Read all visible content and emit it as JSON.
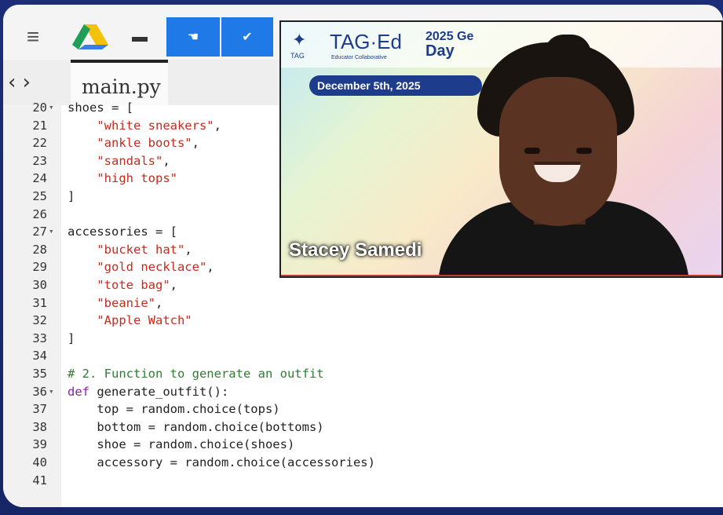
{
  "toolbar": {
    "menu_icon": "hamburger-icon",
    "drive_icon": "drive-icon",
    "hat_icon": "hat-icon",
    "hand_icon": "hand-icon",
    "check_icon": "check-icon"
  },
  "tab": {
    "filename": "main.py"
  },
  "code_lines": [
    {
      "n": "20",
      "fold": "▾",
      "parts": [
        [
          "",
          "shoes = ["
        ]
      ]
    },
    {
      "n": "21",
      "fold": "",
      "parts": [
        [
          "str",
          "    \"white sneakers\""
        ],
        [
          "",
          ","
        ]
      ]
    },
    {
      "n": "22",
      "fold": "",
      "parts": [
        [
          "str",
          "    \"ankle boots\""
        ],
        [
          "",
          ","
        ]
      ]
    },
    {
      "n": "23",
      "fold": "",
      "parts": [
        [
          "str",
          "    \"sandals\""
        ],
        [
          "",
          ","
        ]
      ]
    },
    {
      "n": "24",
      "fold": "",
      "parts": [
        [
          "str",
          "    \"high tops\""
        ]
      ]
    },
    {
      "n": "25",
      "fold": "",
      "parts": [
        [
          "",
          "]"
        ]
      ]
    },
    {
      "n": "26",
      "fold": "",
      "parts": []
    },
    {
      "n": "27",
      "fold": "▾",
      "parts": [
        [
          "",
          "accessories = ["
        ]
      ]
    },
    {
      "n": "28",
      "fold": "",
      "parts": [
        [
          "str",
          "    \"bucket hat\""
        ],
        [
          "",
          ","
        ]
      ]
    },
    {
      "n": "29",
      "fold": "",
      "parts": [
        [
          "str",
          "    \"gold necklace\""
        ],
        [
          "",
          ","
        ]
      ]
    },
    {
      "n": "30",
      "fold": "",
      "parts": [
        [
          "str",
          "    \"tote bag\""
        ],
        [
          "",
          ","
        ]
      ]
    },
    {
      "n": "31",
      "fold": "",
      "parts": [
        [
          "str",
          "    \"beanie\""
        ],
        [
          "",
          ","
        ]
      ]
    },
    {
      "n": "32",
      "fold": "",
      "parts": [
        [
          "str",
          "    \"Apple Watch\""
        ]
      ]
    },
    {
      "n": "33",
      "fold": "",
      "parts": [
        [
          "",
          "]"
        ]
      ]
    },
    {
      "n": "34",
      "fold": "",
      "parts": []
    },
    {
      "n": "35",
      "fold": "",
      "parts": [
        [
          "cm",
          "# 2. Function to generate an outfit"
        ]
      ]
    },
    {
      "n": "36",
      "fold": "▾",
      "parts": [
        [
          "kw",
          "def"
        ],
        [
          "",
          " generate_outfit():"
        ]
      ]
    },
    {
      "n": "37",
      "fold": "",
      "parts": [
        [
          "",
          "    top = random.choice(tops)"
        ]
      ]
    },
    {
      "n": "38",
      "fold": "",
      "parts": [
        [
          "",
          "    bottom = random.choice(bottoms)"
        ]
      ]
    },
    {
      "n": "39",
      "fold": "",
      "parts": [
        [
          "",
          "    shoe = random.choice(shoes)"
        ]
      ]
    },
    {
      "n": "40",
      "fold": "",
      "parts": [
        [
          "",
          "    accessory = random.choice(accessories)"
        ]
      ]
    },
    {
      "n": "41",
      "fold": "",
      "parts": []
    }
  ],
  "video": {
    "org": "TAG·Ed",
    "org_small": "TAG",
    "org_collab": "Educator Collaborative",
    "event_line1": "2025 Ge",
    "event_line2": "Day",
    "date": "December 5th, 2025",
    "speaker_name": "Stacey Samedi"
  },
  "colors": {
    "string": "#c62b1f",
    "keyword": "#8a1fb5",
    "comment": "#2e7d32",
    "frame": "#1b2a6b",
    "accent_blue": "#1f7ae8"
  }
}
